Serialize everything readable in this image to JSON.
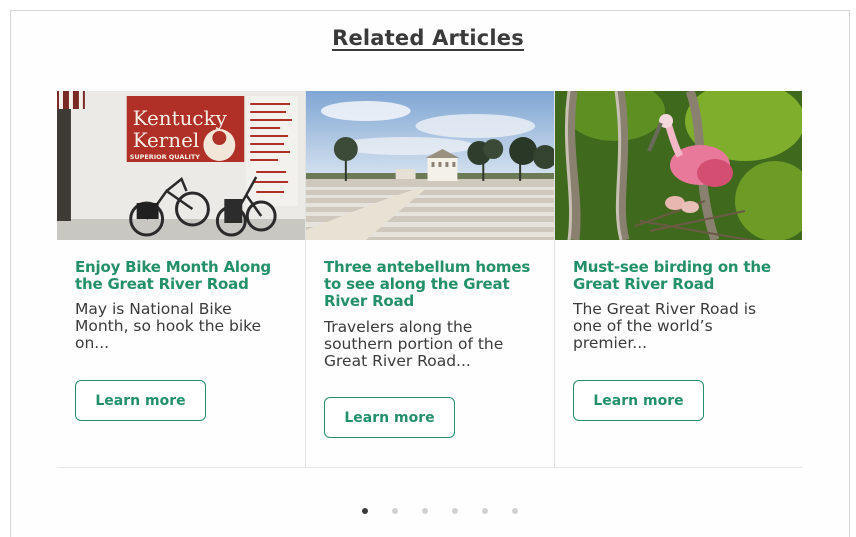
{
  "section": {
    "title": "Related Articles"
  },
  "articles": [
    {
      "title": "Enjoy Bike Month Along the Great River Road",
      "description": "May is National Bike Month, so hook the bike on...",
      "button": "Learn more",
      "image_sign": {
        "line1": "Kentucky",
        "line2": "Kernel",
        "line3": "SUPERIOR QUALITY"
      }
    },
    {
      "title": "Three antebellum homes to see along the Great River Road",
      "description": "Travelers along the southern portion of the Great River Road...",
      "button": "Learn more"
    },
    {
      "title": "Must-see birding on the Great River Road",
      "description": "The Great River Road is one of the world’s premier...",
      "button": "Learn more"
    }
  ],
  "pagination": {
    "total": 6,
    "active": 0
  },
  "colors": {
    "accent": "#23906a",
    "title": "#3a3a3a",
    "text": "#3b3b3b"
  }
}
